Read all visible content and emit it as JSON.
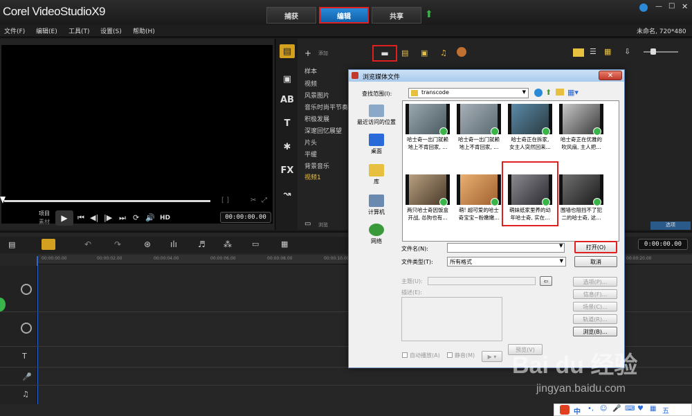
{
  "app": {
    "logo": "Corel VideoStudioX9",
    "project_info": "未命名, 720*480"
  },
  "mode_tabs": [
    {
      "label": "捕获"
    },
    {
      "label": "编辑"
    },
    {
      "label": "共享"
    }
  ],
  "menu": [
    "文件(F)",
    "编辑(E)",
    "工具(T)",
    "设置(S)",
    "帮助(H)"
  ],
  "preview": {
    "project_label": "项目",
    "clip_label": "素材",
    "hd_label": "HD",
    "timecode": "00:00:00.00"
  },
  "library": {
    "add_label": "添加",
    "browse_label": "浏览",
    "options_label": "选项",
    "items": [
      "样本",
      "视频",
      "风景图片",
      "音乐时尚平节奏",
      "积极发展",
      "深邃回忆展望",
      "片头",
      "平缓",
      "背景音乐",
      "视频1"
    ]
  },
  "timeline": {
    "timecode": "0:00:00.00",
    "ruler_ticks": [
      "00:00:00.00",
      "00:00:02.00",
      "00:00:04.00",
      "00:00:06.00",
      "00:00:08.00",
      "00:00:10.00",
      "00:00:20.00"
    ]
  },
  "dialog": {
    "title": "浏览媒体文件",
    "lookin_label": "查找范围(I):",
    "lookin_value": "transcode",
    "places": [
      "最近访问的位置",
      "桌面",
      "库",
      "计算机",
      "网络"
    ],
    "files": [
      {
        "line1": "哈士奇一出门就赖",
        "line2": "地上不肯回家, ..."
      },
      {
        "line1": "哈士奇一出门就赖",
        "line2": "地上不肯回家, ..."
      },
      {
        "line1": "哈士奇正在拆家,",
        "line2": "女主人突然回来..."
      },
      {
        "line1": "哈士奇正在优雅的",
        "line2": "吹风扇, 主人把..."
      },
      {
        "line1": "两只哈士奇因饭盒",
        "line2": "开战, 怂狗也有..."
      },
      {
        "line1": "萌! 超可爱的哈士",
        "line2": "奇宝宝~粉嫩嫩..."
      },
      {
        "line1": "萌妹纸家里养的幼",
        "line2": "年哈士奇, 实在..."
      },
      {
        "line1": "围墙也阻挡不了犯",
        "line2": "二的哈士奇, 这..."
      }
    ],
    "filename_label": "文件名(N):",
    "filename_value": "",
    "filetype_label": "文件类型(T):",
    "filetype_value": "所有格式",
    "open_label": "打开(O)",
    "cancel_label": "取消",
    "subject_label": "主题(U):",
    "description_label": "描述(E):",
    "autoplay_label": "自动播放(A)",
    "mute_label": "静音(M)",
    "preview_label": "预览(V)",
    "side_buttons": [
      "选项(P)...",
      "信息(F)...",
      "场景(C)...",
      "轨道(R)...",
      "浏览(B)..."
    ]
  },
  "watermark": {
    "brand": "Bai du 经验",
    "url": "jingyan.baidu.com"
  },
  "ime": {
    "label": "中"
  }
}
